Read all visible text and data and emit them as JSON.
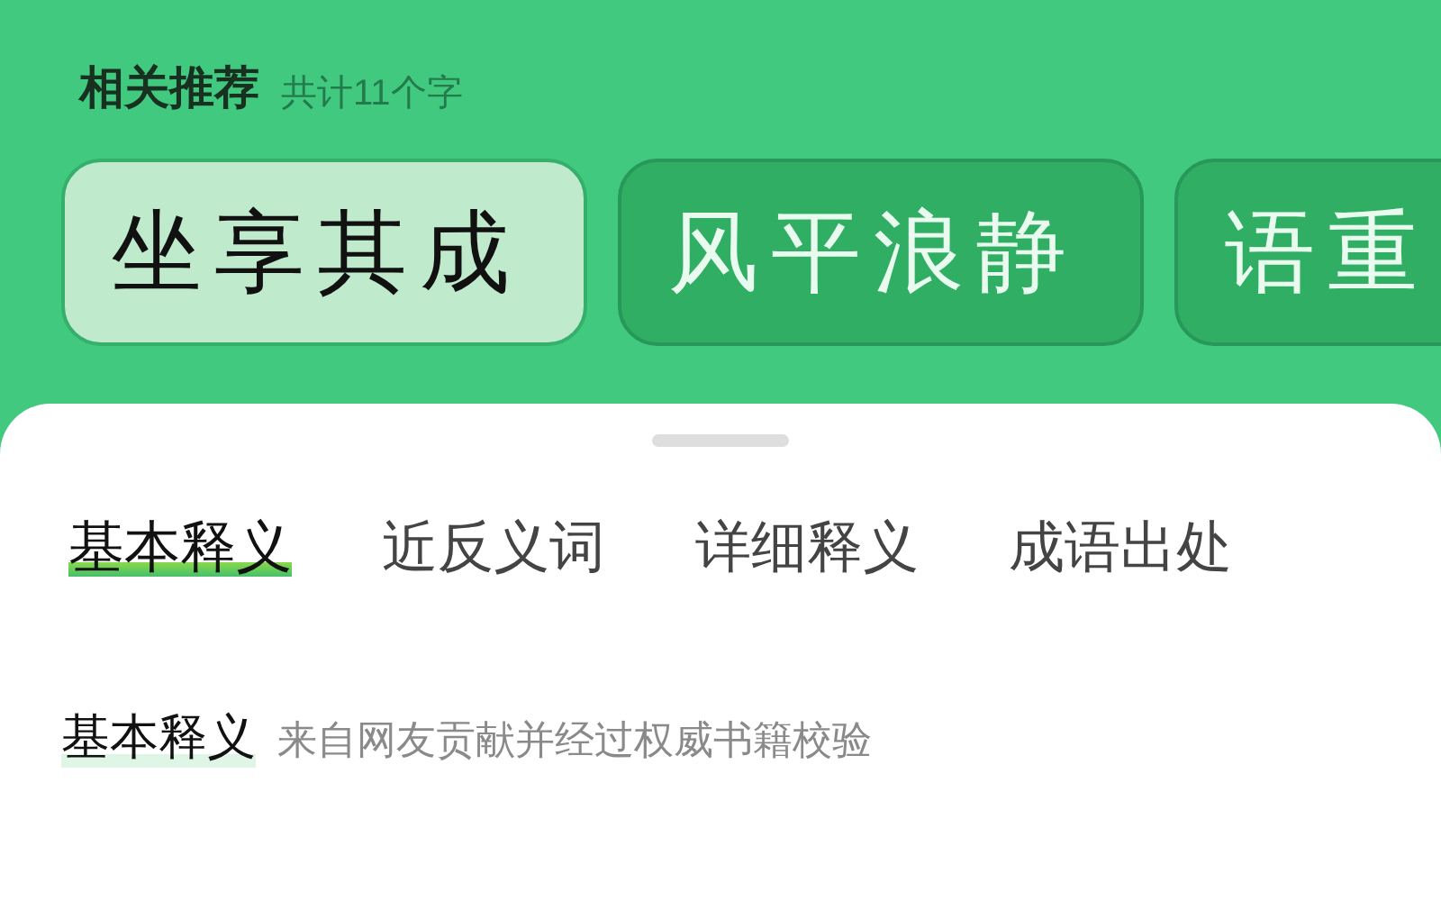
{
  "header": {
    "title": "相关推荐",
    "count": "共计11个字"
  },
  "idioms": [
    {
      "text": "坐享其成",
      "selected": true
    },
    {
      "text": "风平浪静",
      "selected": false
    },
    {
      "text": "语重",
      "selected": false
    }
  ],
  "tabs": [
    {
      "label": "基本释义",
      "selected": true
    },
    {
      "label": "近反义词",
      "selected": false
    },
    {
      "label": "详细释义",
      "selected": false
    },
    {
      "label": "成语出处",
      "selected": false
    }
  ],
  "section": {
    "title": "基本释义",
    "source": "来自网友贡献并经过权威书籍校验"
  }
}
